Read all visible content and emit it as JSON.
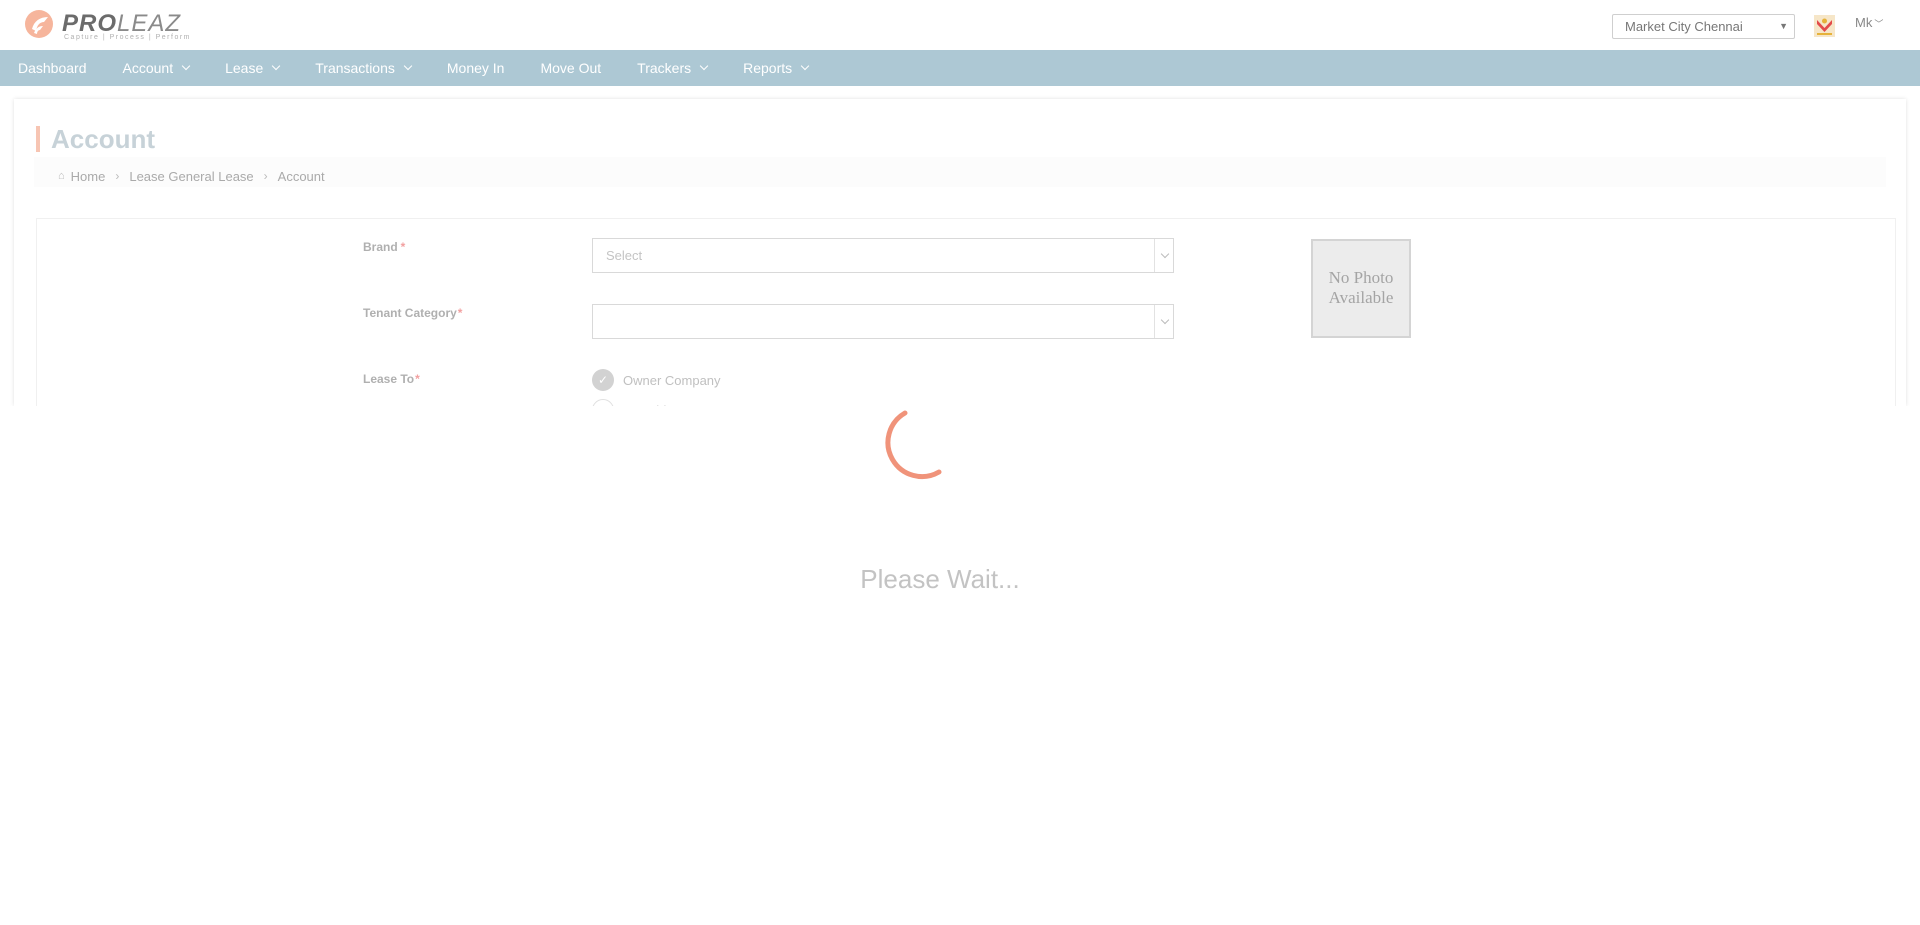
{
  "header": {
    "logo": {
      "brand_strong": "PRO",
      "brand_light": "LEAZ",
      "tagline": "Capture | Process | Perform"
    },
    "site_selector": {
      "value": "Market City Chennai"
    },
    "user": {
      "name": "Mk"
    }
  },
  "nav": {
    "items": [
      {
        "label": "Dashboard",
        "has_dropdown": false
      },
      {
        "label": "Account",
        "has_dropdown": true
      },
      {
        "label": "Lease",
        "has_dropdown": true
      },
      {
        "label": "Transactions",
        "has_dropdown": true
      },
      {
        "label": "Money In",
        "has_dropdown": false
      },
      {
        "label": "Move Out",
        "has_dropdown": false
      },
      {
        "label": "Trackers",
        "has_dropdown": true
      },
      {
        "label": "Reports",
        "has_dropdown": true
      }
    ]
  },
  "page": {
    "title": "Account",
    "breadcrumb": [
      "Home",
      "Lease General Lease",
      "Account"
    ]
  },
  "form": {
    "brand": {
      "label": "Brand",
      "required_mark": "*",
      "placeholder": "Select"
    },
    "tenant_category": {
      "label": "Tenant Category",
      "required_mark": "*",
      "value": ""
    },
    "lease_to": {
      "label": "Lease To",
      "required_mark": "*",
      "options": [
        {
          "label": "Owner Company",
          "checked": true
        },
        {
          "label": "Franchise Company",
          "checked": false
        }
      ]
    },
    "photo_placeholder": {
      "line1": "No Photo",
      "line2": "Available"
    }
  },
  "loading": {
    "message": "Please Wait...",
    "spinner_color": "#f0937a"
  },
  "colors": {
    "nav_bg": "#adc8d4",
    "title_accent": "#f7c5b3",
    "required": "#f2a0a0"
  }
}
